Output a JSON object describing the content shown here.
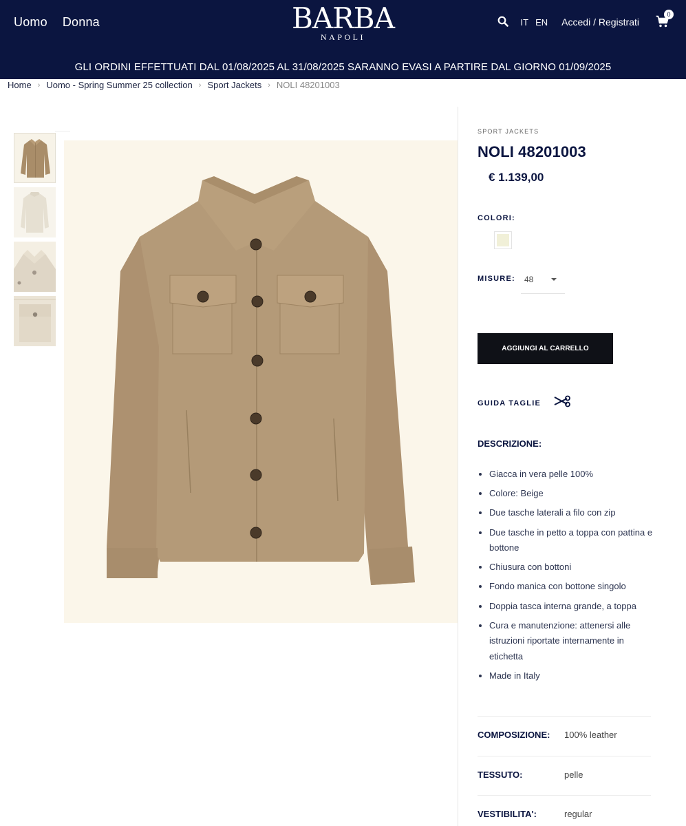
{
  "header": {
    "nav": [
      "Uomo",
      "Donna"
    ],
    "logo": {
      "main": "BARBA",
      "sub": "NAPOLI"
    },
    "languages": [
      "IT",
      "EN"
    ],
    "login": "Accedi / Registrati",
    "cart_count": "0",
    "announcement": "GLI ORDINI EFFETTUATI DAL 01/08/2025 AL 31/08/2025 SARANNO EVASI A PARTIRE DAL GIORNO 01/09/2025"
  },
  "breadcrumb": [
    "Home",
    "Uomo - Spring Summer 25 collection",
    "Sport Jackets",
    "NOLI 48201003"
  ],
  "product": {
    "category": "SPORT JACKETS",
    "title": "NOLI 48201003",
    "price": "€ 1.139,00",
    "colors_label": "COLORI:",
    "color_swatch": "#f1f0d8",
    "sizes_label": "MISURE:",
    "size_selected": "48",
    "add_to_cart": "AGGIUNGI AL CARRELLO",
    "size_guide": "GUIDA TAGLIE",
    "description_label": "DESCRIZIONE:",
    "description": [
      "Giacca in vera pelle 100%",
      "Colore: Beige",
      "Due tasche laterali a filo con zip",
      "Due tasche in petto a toppa con pattina e bottone",
      "Chiusura con bottoni",
      "Fondo manica con bottone singolo",
      "Doppia tasca interna grande, a toppa",
      "Cura e manutenzione: attenersi alle istruzioni riportate internamente in etichetta",
      "Made in Italy"
    ],
    "specs": [
      {
        "key": "COMPOSIZIONE:",
        "value": "100% leather"
      },
      {
        "key": "TESSUTO:",
        "value": "pelle"
      },
      {
        "key": "VESTIBILITA':",
        "value": "regular"
      }
    ]
  },
  "colors": {
    "navy": "#0b1540",
    "button": "#0f1117",
    "jacket": "#b49a78",
    "image_bg": "#fbf6ea"
  }
}
